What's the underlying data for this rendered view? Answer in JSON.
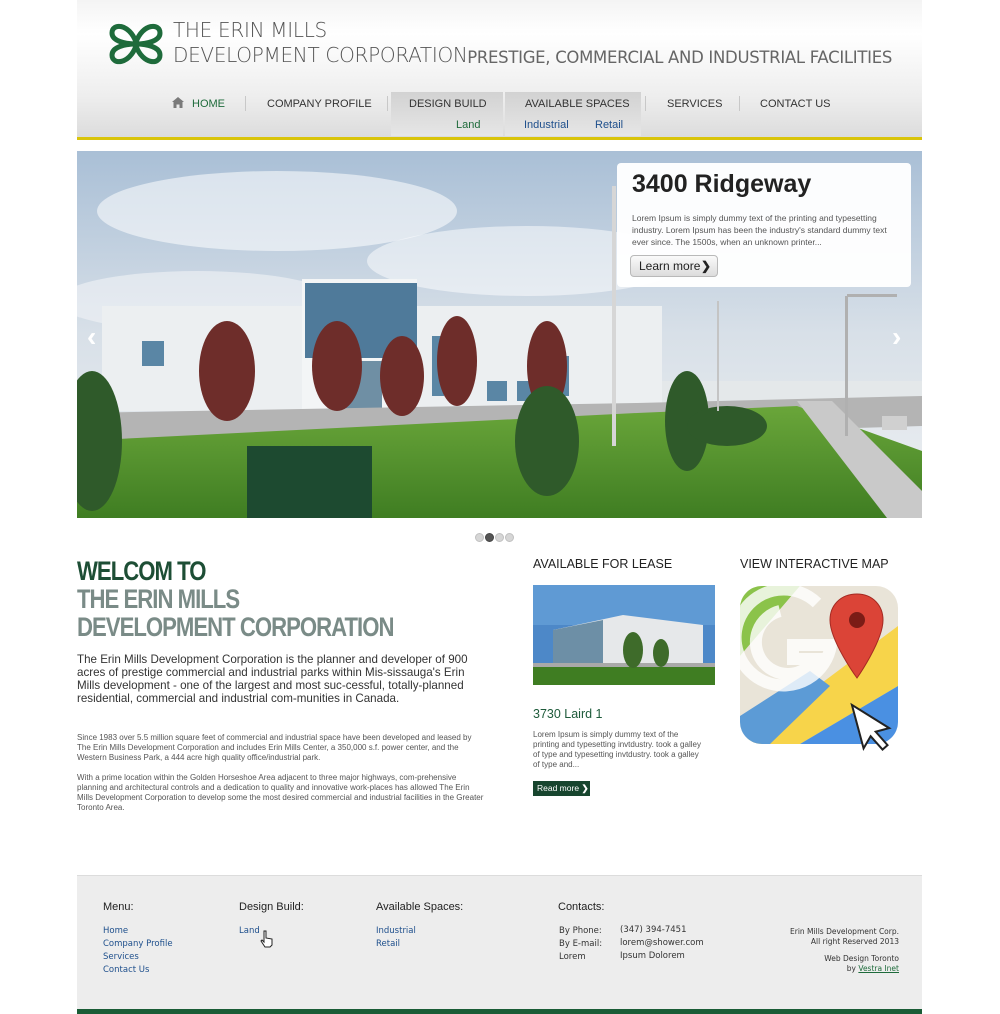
{
  "brand": {
    "name_line1": "THE ERIN MILLS",
    "name_line2": "DEVELOPMENT CORPORATION",
    "tagline": "PRESTIGE, COMMERCIAL AND INDUSTRIAL FACILITIES",
    "color": "#1e6b3b"
  },
  "nav": {
    "home": "HOME",
    "company_profile": "COMPANY PROFILE",
    "design_build": "DESIGN BUILD",
    "design_build_sub": [
      "Land"
    ],
    "available_spaces": "AVAILABLE SPACES",
    "available_spaces_sub": [
      "Industrial",
      "Retail"
    ],
    "services": "SERVICES",
    "contact_us": "CONTACT US"
  },
  "hero": {
    "title": "3400 Ridgeway",
    "text": "Lorem Ipsum is simply dummy text of the printing and typesetting industry. Lorem Ipsum has been the industry's standard dummy text ever since. The 1500s, when an unknown printer...",
    "button": "Learn more",
    "prev": "‹",
    "next": "›",
    "slide_count": 4,
    "active_slide": 2
  },
  "welcome": {
    "line1": "WELCOM TO",
    "line2": "THE ERIN MILLS",
    "line3": "DEVELOPMENT CORPORATION",
    "intro": "The Erin Mills Development Corporation is the planner and developer of 900 acres of prestige commercial and industrial parks within Mis-sissauga's Erin Mills development - one of the largest and most suc-cessful, totally-planned residential, commercial and industrial com-munities in Canada.",
    "para1": "Since 1983 over 5.5 million square feet of commercial and industrial space have been developed and leased by The Erin Mills Development Corporation and includes Erin Mills Center, a 350,000 s.f. power center, and the Western Business Park, a 444 acre high quality office/industrial park.",
    "para2": "With a prime location within the Golden Horseshoe Area adjacent to three major highways, com-prehensive planning and architectural controls and a dedication to quality and innovative work-places has allowed The Erin Mills Development Corporation to develop some the most desired commercial and industrial facilities in the Greater Toronto Area."
  },
  "lease": {
    "heading": "AVAILABLE FOR LEASE",
    "property": "3730 Laird 1",
    "text": "Lorem Ipsum is simply dummy text of the printing and typesetting invtdustry. took a galley of type and typesetting invtdustry. took a galley of type and...",
    "button": "Read more"
  },
  "map": {
    "heading": "VIEW INTERACTIVE MAP"
  },
  "footer": {
    "menu_heading": "Menu:",
    "menu": [
      "Home",
      "Company Profile",
      "Services",
      "Contact Us"
    ],
    "design_heading": "Design Build:",
    "design": [
      "Land"
    ],
    "spaces_heading": "Available Spaces:",
    "spaces": [
      "Industrial",
      "Retail"
    ],
    "contacts_heading": "Contacts:",
    "phone_label": "By Phone:",
    "phone": "(347) 394-7451",
    "email_label": "By E-mail:",
    "email": "lorem@shower.com",
    "lorem_label": "Lorem",
    "lorem_value": "Ipsum Dolorem",
    "copyright1": "Erin Mills Development Corp.",
    "copyright2": "All right Reserved 2013",
    "credit1": "Web Design Toronto",
    "credit_by": "by",
    "credit_link": "Vestra Inet"
  }
}
